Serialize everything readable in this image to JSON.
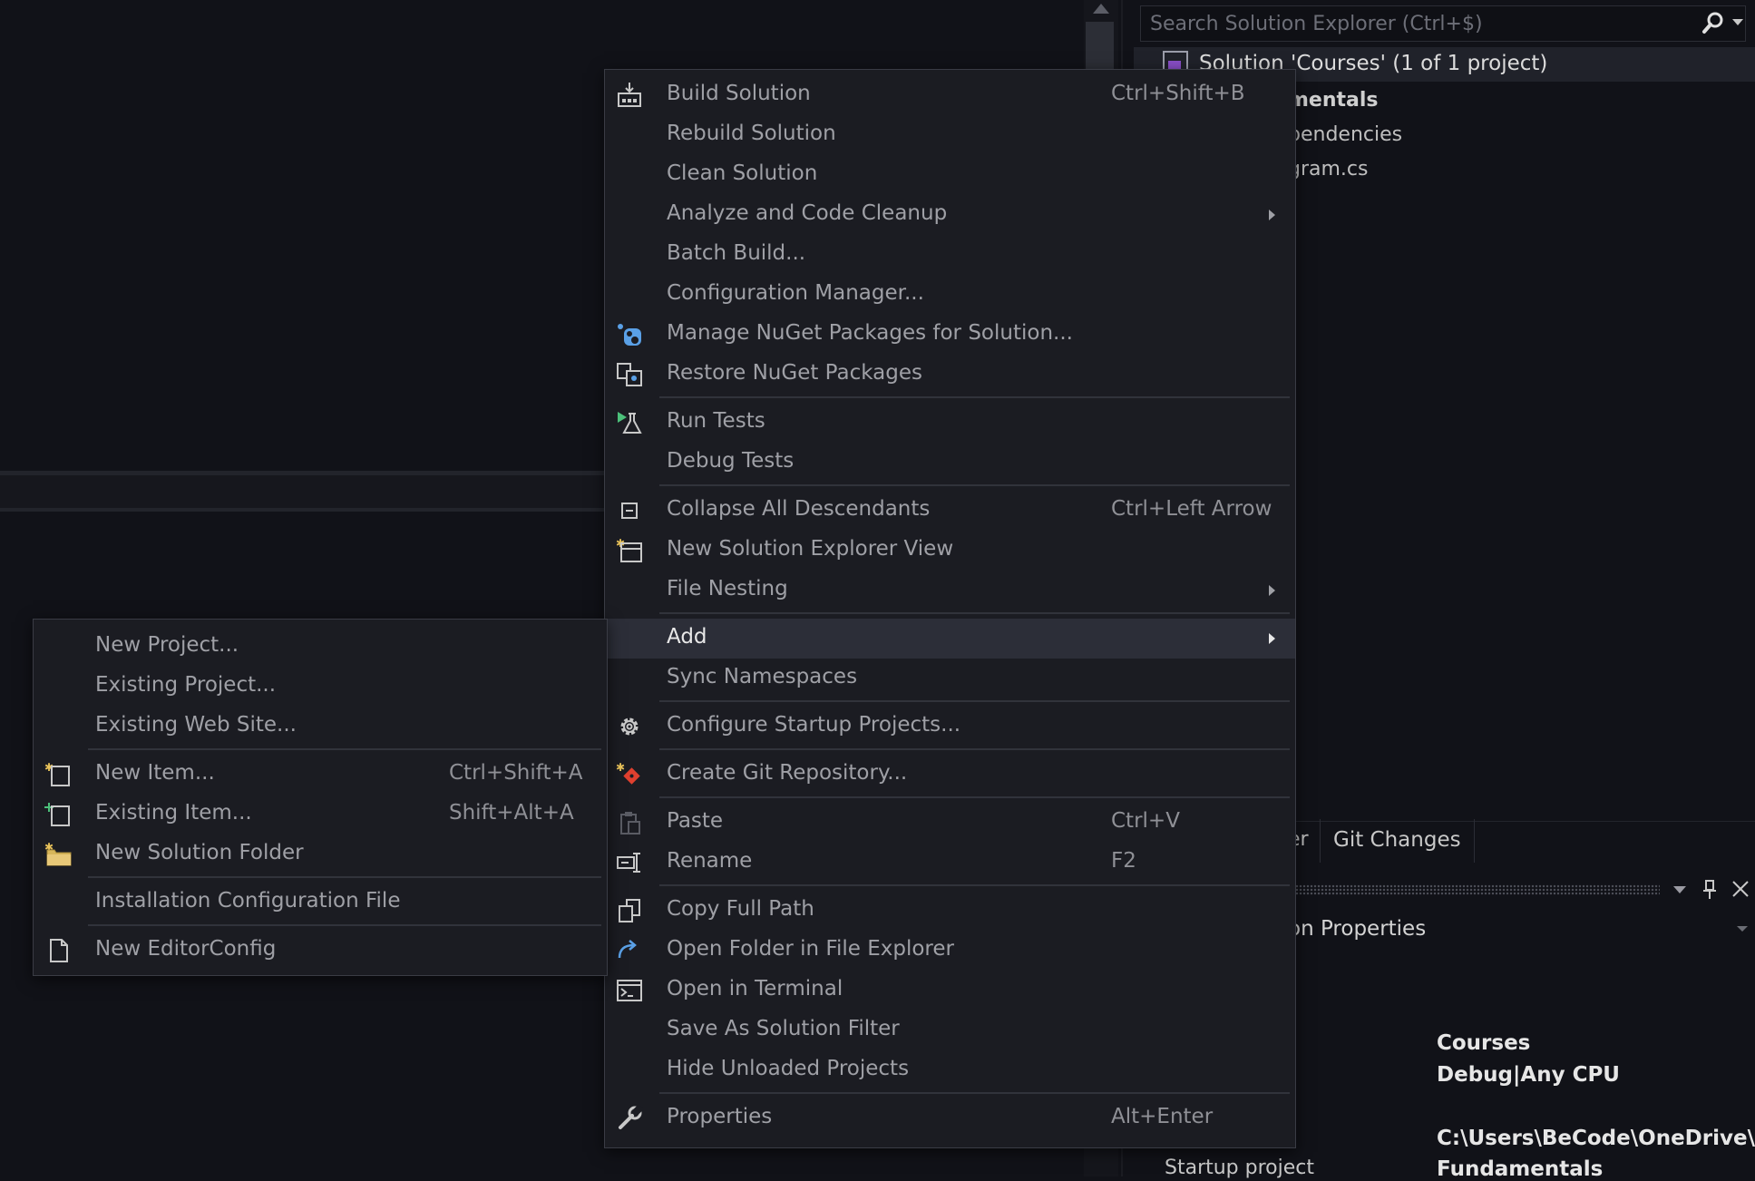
{
  "solution_explorer": {
    "search_placeholder": "Search Solution Explorer (Ctrl+$)",
    "solution_label": "Solution 'Courses' (1 of 1 project)",
    "tree_partial": [
      "mentals",
      "pendencies",
      "gram.cs"
    ]
  },
  "bottom_tabs": {
    "partial_tab": "er",
    "git_changes": "Git Changes"
  },
  "properties": {
    "title_partial": "on Properties",
    "values": [
      "Courses",
      "Debug|Any CPU",
      "C:\\Users\\BeCode\\OneDrive\\Do",
      "Fundamentals"
    ],
    "key_partial": "Startup project"
  },
  "context_menu": {
    "items": [
      {
        "label": "Build Solution",
        "shortcut": "Ctrl+Shift+B",
        "icon": "build-icon"
      },
      {
        "label": "Rebuild Solution",
        "shortcut": ""
      },
      {
        "label": "Clean Solution",
        "shortcut": ""
      },
      {
        "label": "Analyze and Code Cleanup",
        "shortcut": "",
        "submenu": true
      },
      {
        "label": "Batch Build...",
        "shortcut": ""
      },
      {
        "label": "Configuration Manager...",
        "shortcut": ""
      },
      {
        "label": "Manage NuGet Packages for Solution...",
        "shortcut": "",
        "icon": "nuget-icon"
      },
      {
        "label": "Restore NuGet Packages",
        "shortcut": "",
        "icon": "restore-icon"
      },
      {
        "label": "Run Tests",
        "shortcut": "",
        "icon": "run-tests-icon"
      },
      {
        "label": "Debug Tests",
        "shortcut": ""
      },
      {
        "label": "Collapse All Descendants",
        "shortcut": "Ctrl+Left Arrow",
        "icon": "collapse-icon"
      },
      {
        "label": "New Solution Explorer View",
        "shortcut": "",
        "icon": "new-view-icon"
      },
      {
        "label": "File Nesting",
        "shortcut": "",
        "submenu": true
      },
      {
        "label": "Add",
        "shortcut": "",
        "submenu": true,
        "highlighted": true
      },
      {
        "label": "Sync Namespaces",
        "shortcut": ""
      },
      {
        "label": "Configure Startup Projects...",
        "shortcut": "",
        "icon": "gear-icon"
      },
      {
        "label": "Create Git Repository...",
        "shortcut": "",
        "icon": "git-icon"
      },
      {
        "label": "Paste",
        "shortcut": "Ctrl+V",
        "icon": "paste-icon"
      },
      {
        "label": "Rename",
        "shortcut": "F2",
        "icon": "rename-icon"
      },
      {
        "label": "Copy Full Path",
        "shortcut": "",
        "icon": "copy-icon"
      },
      {
        "label": "Open Folder in File Explorer",
        "shortcut": "",
        "icon": "open-folder-icon"
      },
      {
        "label": "Open in Terminal",
        "shortcut": "",
        "icon": "terminal-icon"
      },
      {
        "label": "Save As Solution Filter",
        "shortcut": ""
      },
      {
        "label": "Hide Unloaded Projects",
        "shortcut": ""
      },
      {
        "label": "Properties",
        "shortcut": "Alt+Enter",
        "icon": "wrench-icon"
      }
    ]
  },
  "add_submenu": {
    "items": [
      {
        "label": "New Project...",
        "shortcut": ""
      },
      {
        "label": "Existing Project...",
        "shortcut": ""
      },
      {
        "label": "Existing Web Site...",
        "shortcut": ""
      },
      {
        "label": "New Item...",
        "shortcut": "Ctrl+Shift+A",
        "icon": "new-item-icon"
      },
      {
        "label": "Existing Item...",
        "shortcut": "Shift+Alt+A",
        "icon": "existing-item-icon"
      },
      {
        "label": "New Solution Folder",
        "shortcut": "",
        "icon": "new-folder-icon"
      },
      {
        "label": "Installation Configuration File",
        "shortcut": ""
      },
      {
        "label": "New EditorConfig",
        "shortcut": "",
        "icon": "file-icon"
      }
    ]
  },
  "colors": {
    "background": "#111218",
    "menu_background": "#1b1c22",
    "highlight": "#2c2e38",
    "text_disabled": "#9fa0a6"
  }
}
